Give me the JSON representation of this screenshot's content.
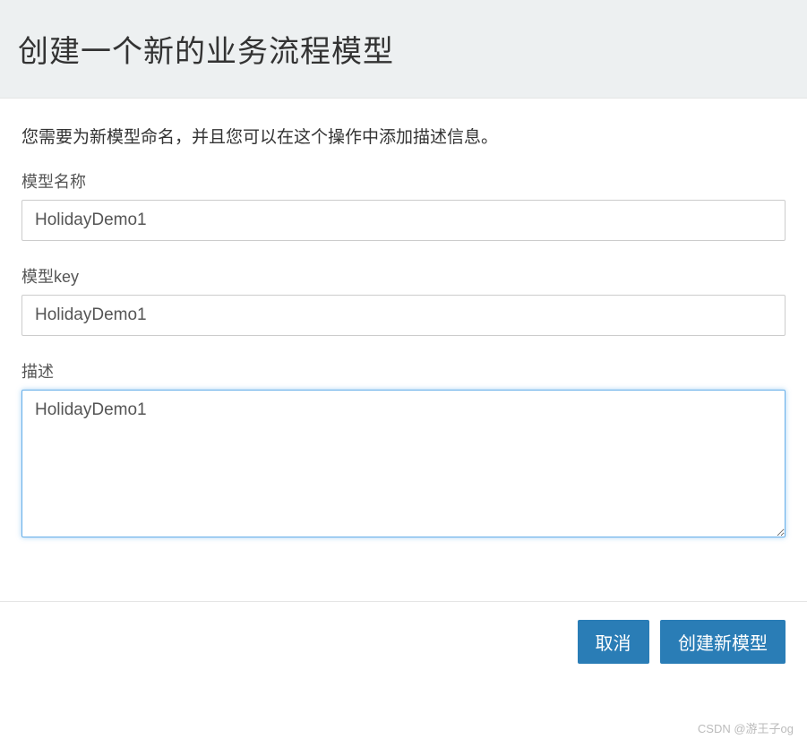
{
  "header": {
    "title": "创建一个新的业务流程模型"
  },
  "body": {
    "help_text": "您需要为新模型命名，并且您可以在这个操作中添加描述信息。",
    "fields": {
      "model_name": {
        "label": "模型名称",
        "value": "HolidayDemo1"
      },
      "model_key": {
        "label": "模型key",
        "value": "HolidayDemo1"
      },
      "description": {
        "label": "描述",
        "value": "HolidayDemo1"
      }
    }
  },
  "footer": {
    "cancel_label": "取消",
    "create_label": "创建新模型"
  },
  "watermark": "CSDN @游王子og"
}
